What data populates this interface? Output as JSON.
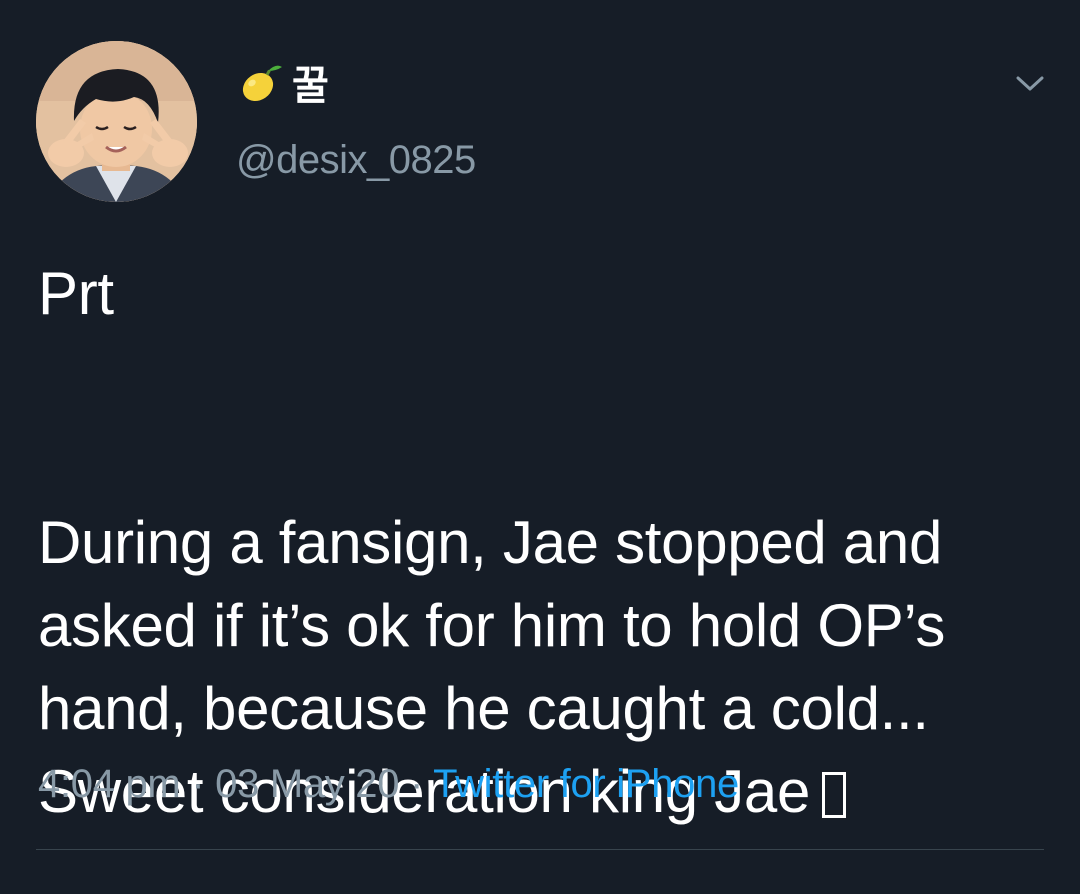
{
  "user": {
    "display_name": "꿀",
    "display_name_emoji": "lemon-emoji",
    "handle": "@desix_0825",
    "avatar": "profile-photo"
  },
  "tweet": {
    "line_1": "Prt",
    "paragraph_lines": [
      "During a fansign, Jae stopped and",
      "asked if it’s ok for him to hold OP’s",
      "hand, because he caught a cold...",
      "Sweet consideration king Jae"
    ]
  },
  "meta": {
    "time": "4:04 pm",
    "separator": "·",
    "date": "03 May 20",
    "source": "Twitter for iPhone"
  },
  "icons": {
    "menu": "chevron-down-icon",
    "missing_glyph": "emoji-placeholder-box"
  },
  "colors": {
    "background": "#161d27",
    "text_primary": "#ffffff",
    "text_secondary": "#8899a6",
    "link": "#1da1f2",
    "divider": "#38444d"
  }
}
